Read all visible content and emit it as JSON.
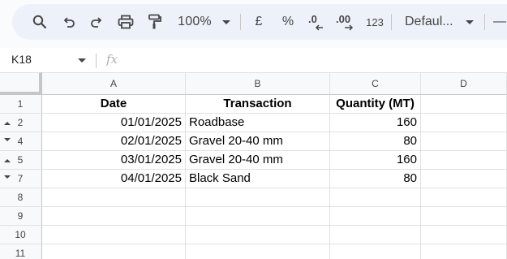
{
  "toolbar": {
    "search_icon": "search-icon",
    "undo_icon": "undo-icon",
    "redo_icon": "redo-icon",
    "print_icon": "print-icon",
    "paint_format_icon": "paint-format-icon",
    "zoom": "100%",
    "currency": "£",
    "percent": "%",
    "decrease_decimal": ".0",
    "increase_decimal": ".00",
    "number_format": "123",
    "font": "Defaul...",
    "minus": "—"
  },
  "formula_bar": {
    "name_box": "K18",
    "fx": "fx"
  },
  "columns": [
    "A",
    "B",
    "C",
    "D"
  ],
  "rows": [
    {
      "num": "1",
      "indicator": "",
      "cells": [
        "Date",
        "Transaction",
        "Quantity (MT)",
        ""
      ]
    },
    {
      "num": "2",
      "indicator": "up",
      "cells": [
        "01/01/2025",
        "Roadbase",
        "160",
        ""
      ]
    },
    {
      "num": "4",
      "indicator": "down",
      "cells": [
        "02/01/2025",
        "Gravel 20-40 mm",
        "80",
        ""
      ]
    },
    {
      "num": "5",
      "indicator": "up",
      "cells": [
        "03/01/2025",
        "Gravel 20-40 mm",
        "160",
        ""
      ]
    },
    {
      "num": "7",
      "indicator": "down",
      "cells": [
        "04/01/2025",
        "Black Sand",
        "80",
        ""
      ]
    },
    {
      "num": "8",
      "indicator": "",
      "cells": [
        "",
        "",
        "",
        ""
      ]
    },
    {
      "num": "9",
      "indicator": "",
      "cells": [
        "",
        "",
        "",
        ""
      ]
    },
    {
      "num": "10",
      "indicator": "",
      "cells": [
        "",
        "",
        "",
        ""
      ]
    },
    {
      "num": "11",
      "indicator": "",
      "cells": [
        "",
        "",
        "",
        ""
      ]
    }
  ]
}
